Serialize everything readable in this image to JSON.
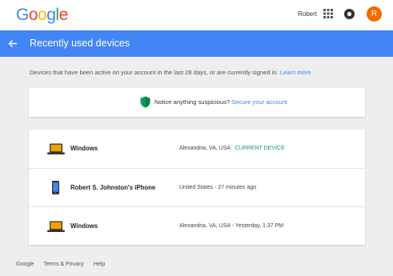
{
  "header": {
    "logo": [
      "G",
      "o",
      "o",
      "g",
      "l",
      "e"
    ],
    "logo_colors": [
      "#4285f4",
      "#ea4335",
      "#fbbc05",
      "#4285f4",
      "#34a853",
      "#ea4335"
    ],
    "user_name": "Robert",
    "avatar_letter": "R",
    "avatar_color": "#ef6c00",
    "icons": [
      "apps-grid-icon",
      "notifications-icon"
    ]
  },
  "title_bar": {
    "title": "Recently used devices",
    "background": "#4285f4",
    "back_icon": "back-arrow-icon"
  },
  "intro": {
    "text": "Devices that have been active on your account in the last 28 days, or are currently signed in.",
    "link": "Learn more"
  },
  "notice": {
    "text": "Notice anything suspicious?",
    "link": "Secure your account",
    "icon": "shield-icon"
  },
  "devices": [
    {
      "name": "Windows",
      "icon": "laptop-icon",
      "location": "Alexandria, VA, USA",
      "status": "CURRENT DEVICE"
    },
    {
      "name": "Robert S. Johnston's iPhone",
      "icon": "phone-icon",
      "location": "United States - 27 minutes ago",
      "status": ""
    },
    {
      "name": "Windows",
      "icon": "laptop-icon",
      "location": "Alexandria, VA, USA - Yesterday, 1:37 PM",
      "status": ""
    }
  ],
  "footer": {
    "links": [
      "Google",
      "Terms & Privacy",
      "Help"
    ]
  }
}
